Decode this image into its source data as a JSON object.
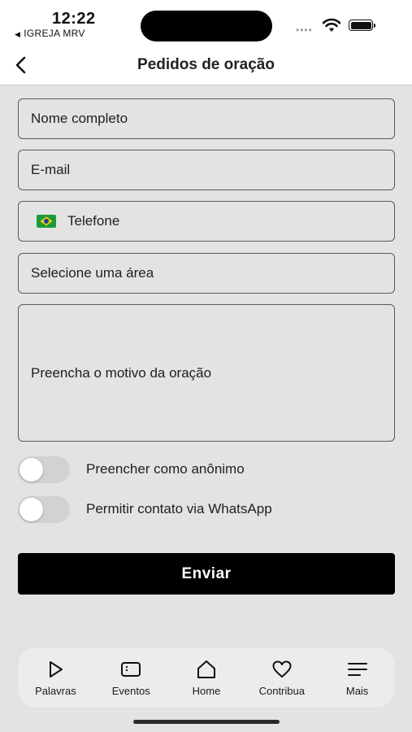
{
  "status_bar": {
    "time": "12:22",
    "back_app": "IGREJA MRV",
    "back_app_icon": "back-triangle-icon",
    "signal_dots": "••••"
  },
  "header": {
    "title": "Pedidos de oração",
    "back_icon": "chevron-left-icon"
  },
  "form": {
    "name_placeholder": "Nome completo",
    "email_placeholder": "E-mail",
    "phone_placeholder": "Telefone",
    "phone_flag": "brazil-flag-icon",
    "area_placeholder": "Selecione uma área",
    "reason_placeholder": "Preencha o motivo da oração",
    "anonymous_label": "Preencher como anônimo",
    "anonymous_on": false,
    "whatsapp_label": "Permitir contato via WhatsApp",
    "whatsapp_on": false,
    "submit_label": "Enviar"
  },
  "tab_bar": {
    "tabs": [
      {
        "label": "Palavras",
        "icon": "play-icon"
      },
      {
        "label": "Eventos",
        "icon": "ticket-icon"
      },
      {
        "label": "Home",
        "icon": "home-icon"
      },
      {
        "label": "Contribua",
        "icon": "heart-icon"
      },
      {
        "label": "Mais",
        "icon": "menu-icon"
      }
    ]
  },
  "colors": {
    "background": "#e3e3e3",
    "button": "#000000",
    "field_border": "#5a5a5a",
    "flag_green": "#1c9b3b",
    "flag_yellow": "#f5d000",
    "flag_blue": "#1f3f9b"
  }
}
